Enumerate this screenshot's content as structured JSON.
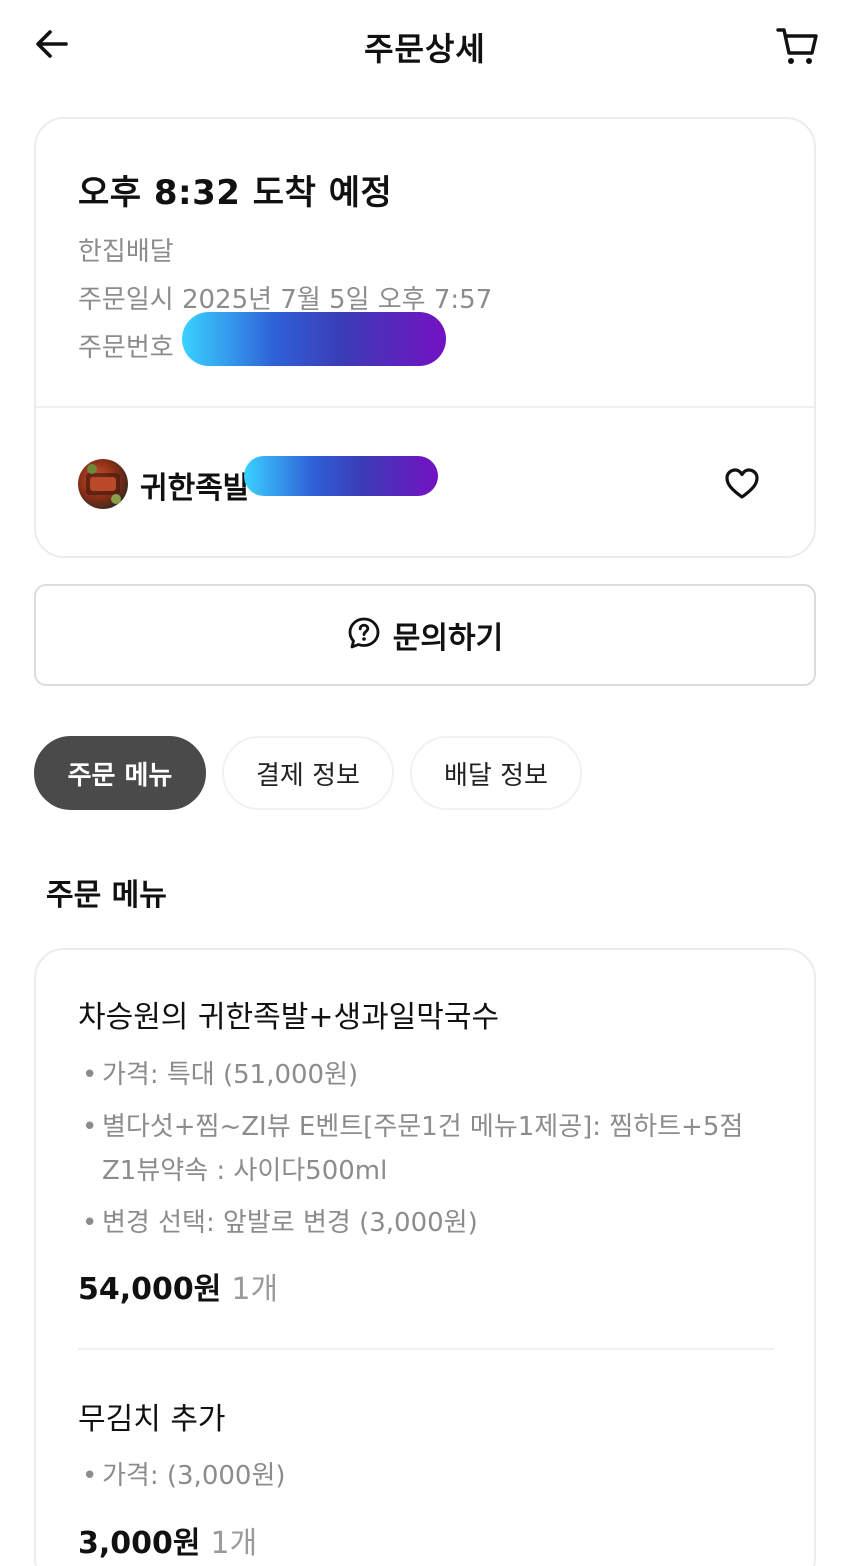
{
  "header": {
    "title": "주문상세"
  },
  "order": {
    "eta": "오후 8:32 도착 예정",
    "delivery_type": "한집배달",
    "order_datetime": "주문일시 2025년 7월 5일 오후 7:57",
    "order_number_label": "주문번호"
  },
  "store": {
    "name": "귀한족발"
  },
  "inquiry": {
    "label": "문의하기"
  },
  "tabs": [
    {
      "label": "주문 메뉴",
      "active": true
    },
    {
      "label": "결제 정보",
      "active": false
    },
    {
      "label": "배달 정보",
      "active": false
    }
  ],
  "section": {
    "title": "주문 메뉴"
  },
  "menu_items": [
    {
      "name": "차승원의 귀한족발+생과일막국수",
      "options": [
        "가격: 특대 (51,000원)",
        "별다섯+찜~ZI뷰 E벤트[주문1건 메뉴1제공]: 찜하트+5점",
        "Z1뷰약속 : 사이다500ml",
        "변경 선택: 앞발로 변경 (3,000원)"
      ],
      "price": "54,000원",
      "quantity": "1개"
    },
    {
      "name": "무김치 추가",
      "options": [
        "가격: (3,000원)"
      ],
      "price": "3,000원",
      "quantity": "1개"
    }
  ],
  "colors": {
    "active_tab_bg": "#4a4a4a",
    "muted_text": "#8c8c8c",
    "redaction_gradient_start": "#3ad2ff",
    "redaction_gradient_end": "#7411c2"
  }
}
